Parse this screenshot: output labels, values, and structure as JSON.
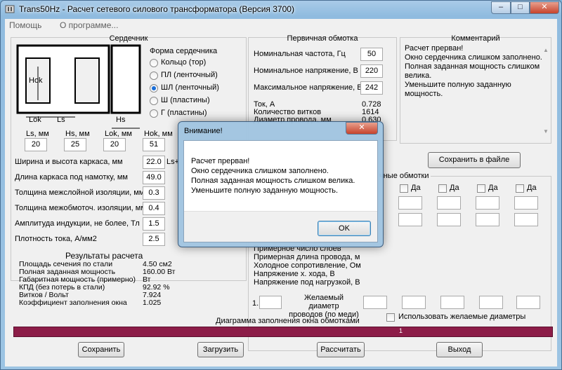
{
  "window": {
    "title": "Trans50Hz - Расчет сетевого силового трансформатора (Версия 3700)"
  },
  "caption_buttons": {
    "minimize": "–",
    "maximize": "□",
    "close": "✕"
  },
  "menu": [
    "Помощь",
    "О программе..."
  ],
  "core": {
    "group_title": "Сердечник",
    "diagram_labels": {
      "hok": "Hok",
      "lok": "Lok",
      "ls": "Ls",
      "hs": "Hs"
    },
    "shape_title": "Форма сердечника",
    "shapes": [
      {
        "label": "Кольцо  (тор)",
        "selected": false
      },
      {
        "label": "ПЛ  (ленточный)",
        "selected": false
      },
      {
        "label": "ШЛ  (ленточный)",
        "selected": true
      },
      {
        "label": "Ш  (пластины)",
        "selected": false
      },
      {
        "label": "Г (пластины)",
        "selected": false
      }
    ],
    "dims": [
      {
        "label": "Ls, мм",
        "value": "20"
      },
      {
        "label": "Hs, мм",
        "value": "25"
      },
      {
        "label": "Lok, мм",
        "value": "20"
      },
      {
        "label": "Hok, мм",
        "value": "51"
      }
    ],
    "params": [
      {
        "label": "Ширина и высота каркаса, мм",
        "value": "22.0"
      },
      {
        "label": "Длина каркаса под намотку, мм",
        "value": "49.0"
      },
      {
        "label": "Толщина межслойной изоляции, мм",
        "value": "0.3"
      },
      {
        "label": "Толщина межобмоточ. изоляции, мм",
        "value": "0.4"
      },
      {
        "label": "Амплитуда индукции, не более, Тл",
        "value": "1.5"
      },
      {
        "label": "Плотность тока, А/мм2",
        "value": "2.5"
      }
    ],
    "ls_hint": "Ls+",
    "results_title": "Результаты расчета",
    "results": [
      {
        "label": "Площадь сечения по стали",
        "value": "4.50 см2"
      },
      {
        "label": "Полная заданная мощность",
        "value": "160.00 Вт"
      },
      {
        "label": "Габаритная мощность (примерно)",
        "value": "Вт"
      },
      {
        "label": "КПД (без потерь в стали)",
        "value": "92.92 %"
      },
      {
        "label": "Витков / Вольт",
        "value": "7.924"
      },
      {
        "label": "Коэффициент заполнения окна",
        "value": "1.025"
      }
    ]
  },
  "primary": {
    "group_title": "Первичная обмотка",
    "inputs": [
      {
        "label": "Номинальная частота, Гц",
        "value": "50"
      },
      {
        "label": "Номинальное напряжение, В",
        "value": "220"
      },
      {
        "label": "Максимальное напряжение, В",
        "value": "242"
      }
    ],
    "outputs": [
      {
        "label": "Ток, А",
        "value": "0.728"
      },
      {
        "label": "Количество витков",
        "value": "1614"
      },
      {
        "label": "Диаметр провода, мм",
        "value": "0.630"
      }
    ]
  },
  "comment": {
    "title": "Комментарий",
    "text": "Расчет прерван!\nОкно сердечника слишком заполнено.\nПолная заданная мощность слишком велика.\nУменьшите полную заданную мощность."
  },
  "save_file_button": "Сохранить в файле",
  "secondary": {
    "group_title_visible": "чные обмотки",
    "checkbox_label": "Да",
    "row_labels": [
      "Примерное число слоев",
      "Примерная длина провода, м",
      "Холодное сопротивление, Ом",
      "Напряжение х. хода, В",
      "Напряжение под нагрузкой, В"
    ],
    "row_number": "1.",
    "desired_diameter": "Желаемый диаметр\nпроводов  (по меди)",
    "use_desired": "Использовать желаемые диаметры"
  },
  "fill_bar": {
    "title": "Диаграмма заполнения окна обмотками",
    "marker": "1",
    "fill": 1.0,
    "color": "#8c1d48"
  },
  "buttons": {
    "save": "Сохранить",
    "load": "Загрузить",
    "calc": "Рассчитать",
    "exit": "Выход"
  },
  "dialog": {
    "title": "Внимание!",
    "message": "Расчет прерван!\nОкно сердечника слишком заполнено.\nПолная заданная мощность слишком велика.\nУменьшите полную заданную мощность.",
    "ok": "OK"
  }
}
